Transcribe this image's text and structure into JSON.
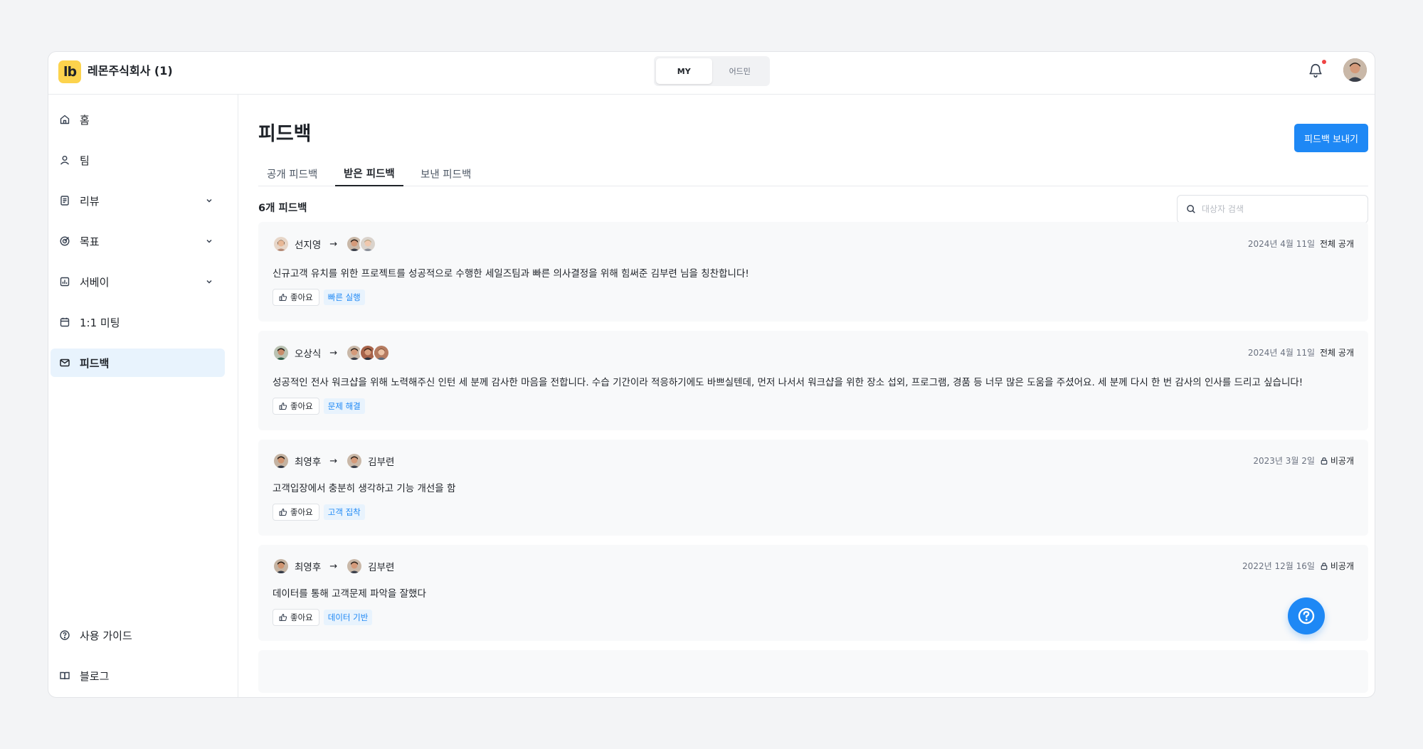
{
  "header": {
    "logo_text": "lb",
    "company": "레몬주식회사 (1)",
    "modes": [
      "MY",
      "어드민"
    ]
  },
  "sidebar": {
    "items": [
      {
        "label": "홈",
        "icon": "home-icon"
      },
      {
        "label": "팀",
        "icon": "user-icon"
      },
      {
        "label": "리뷰",
        "icon": "document-icon"
      },
      {
        "label": "목표",
        "icon": "target-icon"
      },
      {
        "label": "서베이",
        "icon": "chart-icon"
      },
      {
        "label": "1:1 미팅",
        "icon": "calendar-icon"
      },
      {
        "label": "피드백",
        "icon": "mail-icon"
      }
    ],
    "bottom": [
      {
        "label": "사용 가이드",
        "icon": "help-circle-icon"
      },
      {
        "label": "블로그",
        "icon": "book-icon"
      }
    ]
  },
  "main": {
    "title": "피드백",
    "send_button": "피드백 보내기",
    "tabs": [
      "공개 피드백",
      "받은 피드백",
      "보낸 피드백"
    ],
    "count_label": "6개 피드백",
    "search_placeholder": "대상자 검색",
    "like_label": "좋아요"
  },
  "feedbacks": [
    {
      "from": "선지영",
      "to": "",
      "date": "2024년 4월 11일",
      "visibility": "전체 공개",
      "text": "신규고객 유치를 위한 프로젝트를 성공적으로 수행한 세일즈팀과 빠른 의사결정을 위해 힘써준 김부련 님을 칭찬합니다!",
      "tag": "빠른 실행"
    },
    {
      "from": "오상식",
      "to": "",
      "date": "2024년 4월 11일",
      "visibility": "전체 공개",
      "text": "성공적인 전사 워크샵을 위해 노력해주신 인턴 세 분께 감사한 마음을 전합니다. 수습 기간이라 적응하기에도 바쁘실텐데, 먼저 나서서 워크샵을 위한 장소 섭외, 프로그램, 경품 등 너무 많은 도움을 주셨어요. 세 분께 다시 한 번 감사의 인사를 드리고 싶습니다!",
      "tag": "문제 해결"
    },
    {
      "from": "최영후",
      "to": "김부련",
      "date": "2023년 3월 2일",
      "visibility": "비공개",
      "text": "고객입장에서 충분히 생각하고 기능 개선을 함",
      "tag": "고객 집착"
    },
    {
      "from": "최영후",
      "to": "김부련",
      "date": "2022년 12월 16일",
      "visibility": "비공개",
      "text": "데이터를 통해 고객문제 파악을 잘했다",
      "tag": "데이터 기반"
    }
  ],
  "colors": {
    "accent": "#1e88f5",
    "logo": "#fcd34d",
    "active_nav": "#e8f3fd"
  }
}
